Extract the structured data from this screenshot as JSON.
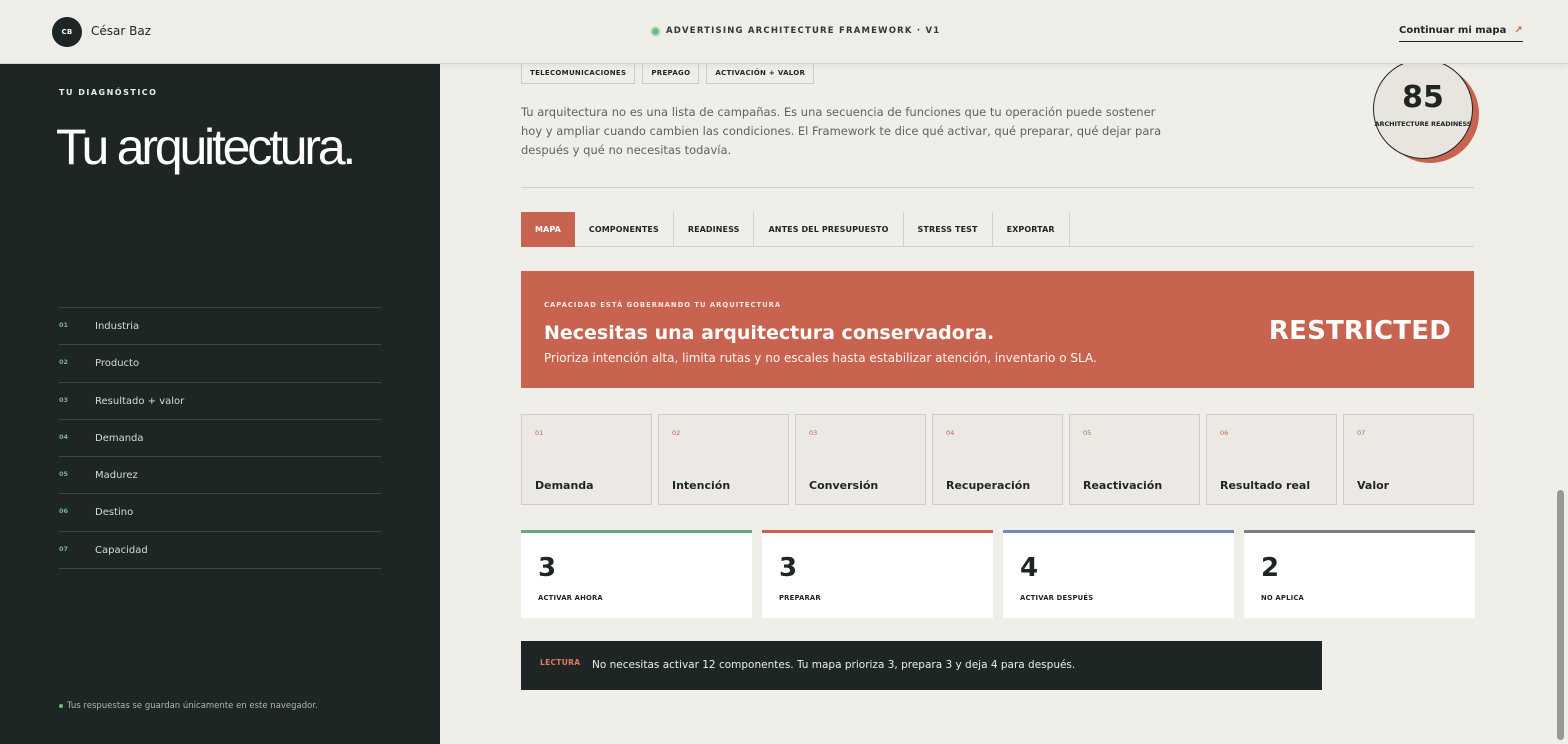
{
  "header": {
    "avatar_initials": "CB",
    "user_name": "César Baz",
    "framework_label": "ADVERTISING ARCHITECTURE FRAMEWORK · V1",
    "continue_label": "Continuar mi mapa",
    "continue_icon": "arrow-up-right-icon",
    "status_color": "#6dbb7f"
  },
  "sidebar": {
    "eyebrow": "TU DIAGNÓSTICO",
    "title": "Tu arquitectura.",
    "steps": [
      {
        "num": "01",
        "label": "Industria"
      },
      {
        "num": "02",
        "label": "Producto"
      },
      {
        "num": "03",
        "label": "Resultado + valor"
      },
      {
        "num": "04",
        "label": "Demanda"
      },
      {
        "num": "05",
        "label": "Madurez"
      },
      {
        "num": "06",
        "label": "Destino"
      },
      {
        "num": "07",
        "label": "Capacidad"
      }
    ],
    "footer": "Tus respuestas se guardan únicamente en este navegador."
  },
  "main": {
    "tags": [
      "TELECOMUNICACIONES",
      "PREPAGO",
      "ACTIVACIÓN + VALOR"
    ],
    "intro": "Tu arquitectura no es una lista de campañas. Es una secuencia de funciones que tu operación puede sostener hoy y ampliar cuando cambien las condiciones. El Framework te dice qué activar, qué preparar, qué dejar para después y qué no necesitas todavía.",
    "score": {
      "value": "85",
      "label": "ARCHITECTURE READINESS"
    },
    "tabs": [
      {
        "label": "MAPA",
        "active": true
      },
      {
        "label": "COMPONENTES",
        "active": false
      },
      {
        "label": "READINESS",
        "active": false
      },
      {
        "label": "ANTES DEL PRESUPUESTO",
        "active": false
      },
      {
        "label": "STRESS TEST",
        "active": false
      },
      {
        "label": "EXPORTAR",
        "active": false
      }
    ],
    "banner": {
      "eyebrow": "CAPACIDAD ESTÁ GOBERNANDO TU ARQUITECTURA",
      "title": "Necesitas una arquitectura conservadora.",
      "subtitle": "Prioriza intención alta, limita rutas y no escales hasta estabilizar atención, inventario o SLA.",
      "status": "RESTRICTED",
      "color": "#c7634f"
    },
    "components": [
      {
        "num": "01",
        "label": "Demanda"
      },
      {
        "num": "02",
        "label": "Intención"
      },
      {
        "num": "03",
        "label": "Conversión"
      },
      {
        "num": "04",
        "label": "Recuperación"
      },
      {
        "num": "05",
        "label": "Reactivación"
      },
      {
        "num": "06",
        "label": "Resultado real"
      },
      {
        "num": "07",
        "label": "Valor"
      }
    ],
    "stats": [
      {
        "value": "3",
        "label": "ACTIVAR AHORA",
        "color": "#6aa77a"
      },
      {
        "value": "3",
        "label": "PREPARAR",
        "color": "#c7634f"
      },
      {
        "value": "4",
        "label": "ACTIVAR DESPUÉS",
        "color": "#6f8bbd"
      },
      {
        "value": "2",
        "label": "NO APLICA",
        "color": "#7d7d7a"
      }
    ],
    "reading": {
      "label": "LECTURA",
      "text": "No necesitas activar 12 componentes. Tu mapa prioriza 3, prepara 3 y deja 4 para después."
    }
  }
}
